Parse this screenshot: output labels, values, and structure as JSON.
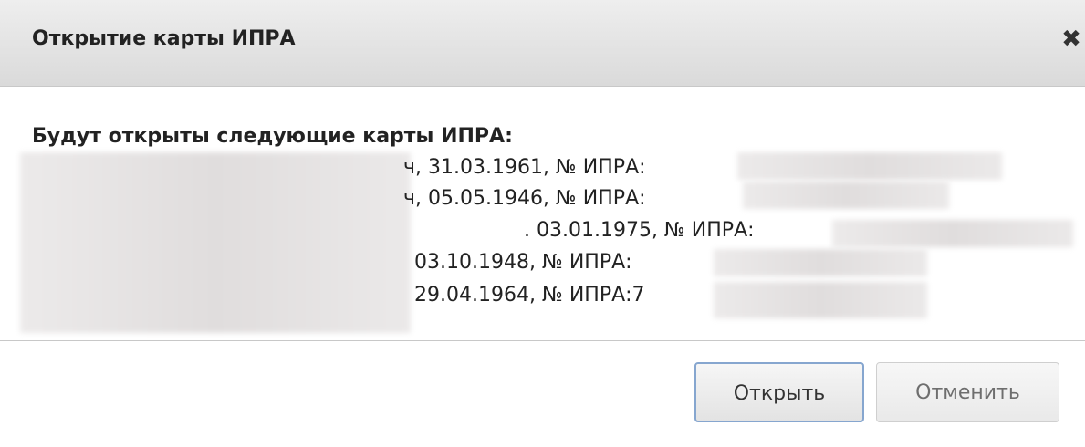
{
  "dialog": {
    "title": "Открытие карты ИПРА",
    "close_symbol": "✖",
    "heading": "Будут открыты следующие карты ИПРА:",
    "cards": [
      {
        "text": "ч, 31.03.1961, № ИПРА:"
      },
      {
        "text": "ч, 05.05.1946, № ИПРА:"
      },
      {
        "text": ". 03.01.1975, № ИПРА:"
      },
      {
        "text": "03.10.1948, № ИПРА:"
      },
      {
        "text": "29.04.1964, № ИПРА:7"
      }
    ],
    "buttons": {
      "open_label": "Открыть",
      "cancel_label": "Отменить"
    }
  }
}
